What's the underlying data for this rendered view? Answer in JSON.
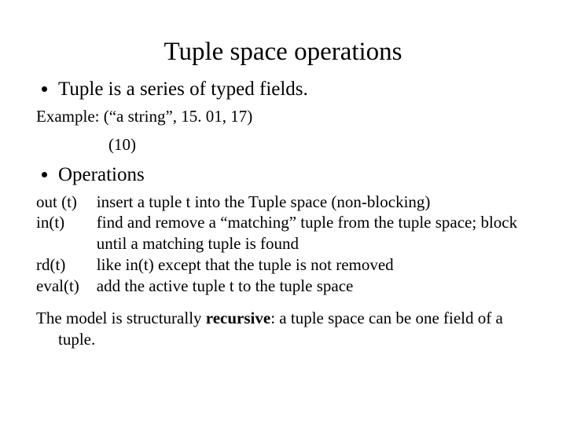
{
  "title": "Tuple space operations",
  "bullets": {
    "b1": "Tuple is a series of typed fields.",
    "b2": "Operations"
  },
  "example": {
    "line1": "Example: (“a string”, 15. 01, 17)",
    "line2": "(10)"
  },
  "ops": {
    "out": {
      "name": "out (t)",
      "desc": "insert a tuple t into the Tuple space (non-blocking)"
    },
    "in": {
      "name": "in(t)",
      "desc": "find and remove a “matching” tuple from the tuple space; block until a matching tuple is found"
    },
    "rd": {
      "name": "rd(t)",
      "desc": "like in(t) except that the tuple is not removed"
    },
    "eval": {
      "name": "eval(t)",
      "desc": "add the active tuple t to the tuple space"
    }
  },
  "closing": {
    "pre": "The model is structurally ",
    "bold": "recursive",
    "post": ": a tuple space can be one field of a tuple."
  }
}
